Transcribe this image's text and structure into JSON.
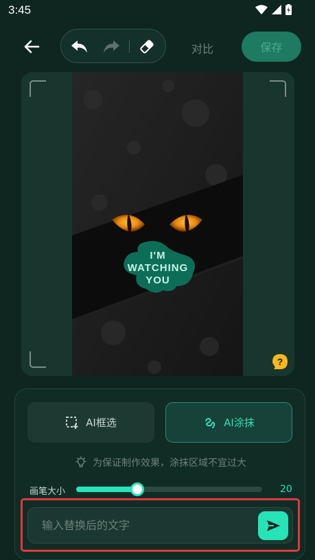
{
  "status_bar": {
    "time": "3:45"
  },
  "toolbar": {
    "back_icon": "arrow-left-icon",
    "undo_icon": "undo-icon",
    "redo_icon": "redo-icon",
    "eraser_icon": "eraser-icon",
    "compare_label": "对比",
    "save_label": "保存"
  },
  "canvas": {
    "image_text_line1": "I'M",
    "image_text_line2": "WATCHING",
    "image_text_line3": "YOU",
    "help_label": "?"
  },
  "panel": {
    "modes": [
      {
        "label": "AI框选",
        "icon": "box-select-icon",
        "active": false
      },
      {
        "label": "AI涂抹",
        "icon": "brush-scribble-icon",
        "active": true
      }
    ],
    "hint": "为保证制作效果，涂抹区域不宜过大",
    "brush": {
      "label": "画笔大小",
      "value": "20",
      "fraction": 0.33
    },
    "input": {
      "placeholder": "输入替换后的文字",
      "value": ""
    }
  },
  "colors": {
    "background": "#0f2620",
    "accent": "#27e3b8",
    "save_button": "#1e7a60",
    "highlight": "#e0393c"
  }
}
